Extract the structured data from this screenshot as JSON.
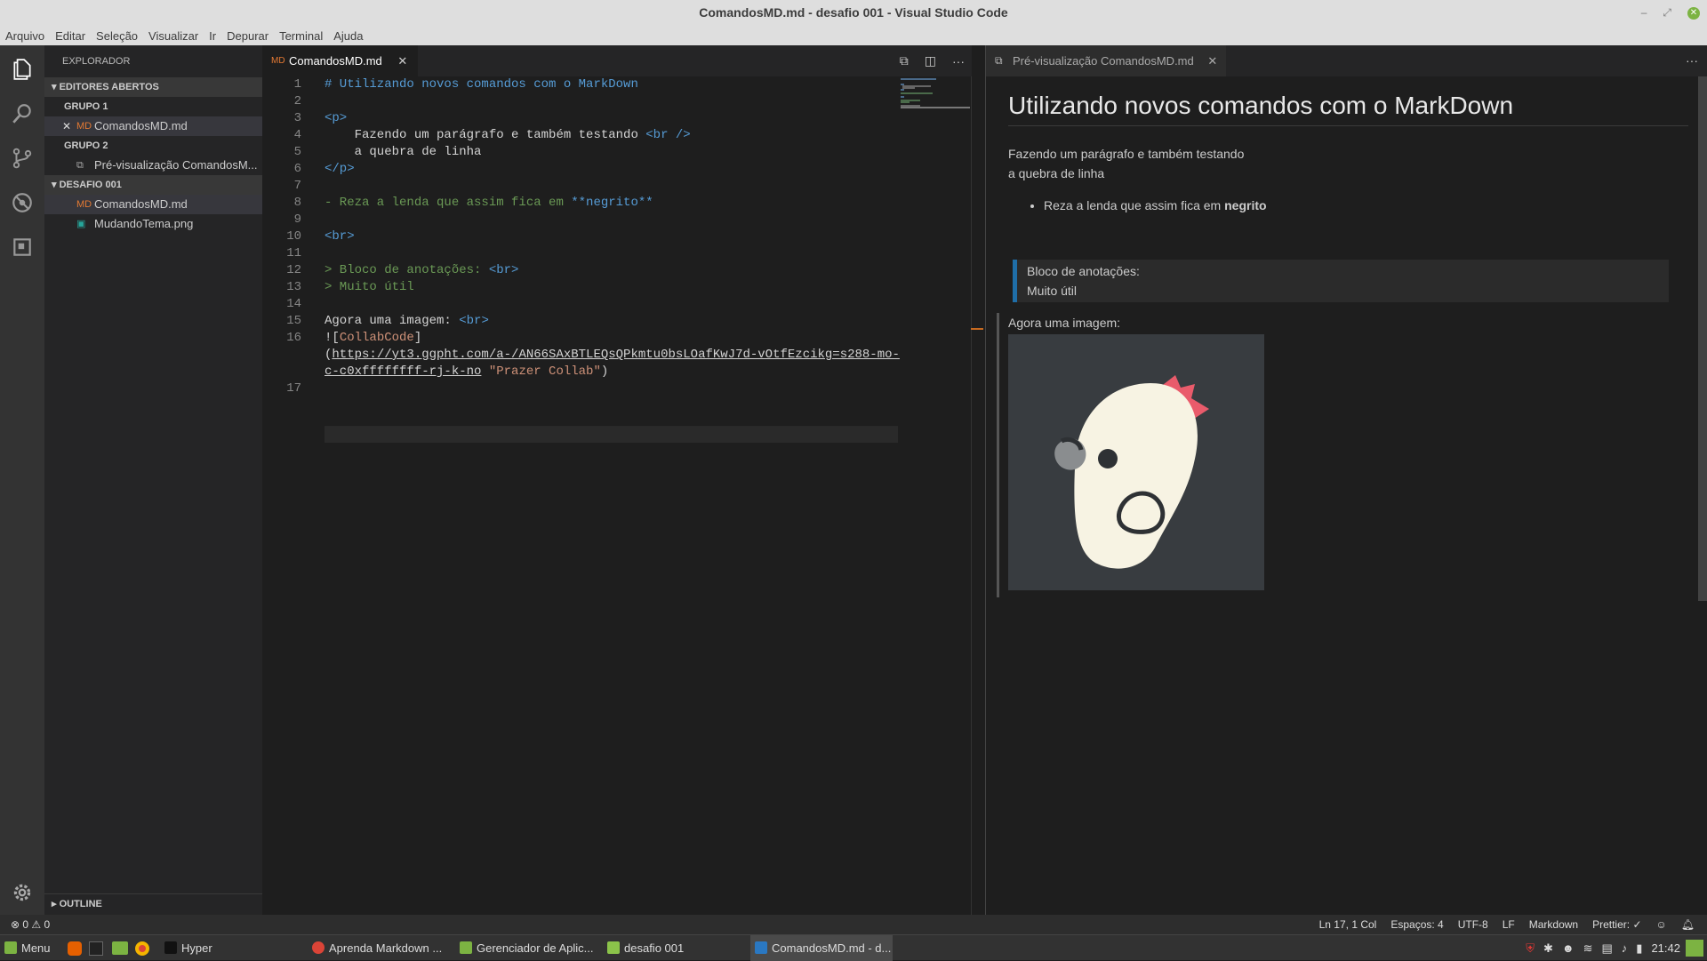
{
  "window": {
    "title": "ComandosMD.md - desafio 001 - Visual Studio Code"
  },
  "menu": [
    "Arquivo",
    "Editar",
    "Seleção",
    "Visualizar",
    "Ir",
    "Depurar",
    "Terminal",
    "Ajuda"
  ],
  "sidebar": {
    "title": "EXPLORADOR",
    "open_editors": "EDITORES ABERTOS",
    "group1": "GRUPO 1",
    "group1_file": "ComandosMD.md",
    "group2": "GRUPO 2",
    "group2_file": "Pré-visualização ComandosM...",
    "folder": "DESAFIO 001",
    "files": [
      "ComandosMD.md",
      "MudandoTema.png"
    ],
    "outline": "OUTLINE"
  },
  "editor": {
    "tab_label": "ComandosMD.md",
    "line_numbers": [
      "1",
      "2",
      "3",
      "4",
      "5",
      "6",
      "7",
      "8",
      "9",
      "10",
      "11",
      "12",
      "13",
      "14",
      "15",
      "16",
      "17"
    ],
    "lines": {
      "l1": "# Utilizando novos comandos com o MarkDown",
      "l3": "<p>",
      "l4_text": "    Fazendo um parágrafo e também testando ",
      "l4_tag": "<br />",
      "l5": "    a quebra de linha",
      "l6": "</p>",
      "l8_text": "- Reza a lenda que assim fica em ",
      "l8_bold": "**negrito**",
      "l10": "<br>",
      "l12_text": "> Bloco de anotações: ",
      "l12_tag": "<br>",
      "l13": "> Muito útil",
      "l15_text": "Agora uma imagem: ",
      "l15_tag": "<br>",
      "l16_a": "![",
      "l16_b": "CollabCode",
      "l16_c": "]",
      "l16_d": "(",
      "l16_url1": "https://yt3.ggpht.com/a-/AN66SAxBTLEQsQPkmtu0bsLOafKwJ7d-vOtfEzcikg=s288-mo-",
      "l16_url2": "c-c0xffffffff-rj-k-no",
      "l16_title": " \"Prazer Collab\"",
      "l16_end": ")"
    }
  },
  "preview": {
    "tab_label": "Pré-visualização ComandosMD.md",
    "h1": "Utilizando novos comandos com o MarkDown",
    "para_line1": "Fazendo um parágrafo e também testando",
    "para_line2": "a quebra de linha",
    "list_text": "Reza a lenda que assim fica em ",
    "list_bold": "negrito",
    "quote_line1": "Bloco de anotações:",
    "quote_line2": "Muito útil",
    "image_label": "Agora uma imagem:"
  },
  "status": {
    "errors": "0",
    "warnings": "0",
    "position": "Ln 17, 1 Col",
    "spaces": "Espaços: 4",
    "encoding": "UTF-8",
    "eol": "LF",
    "language": "Markdown",
    "prettier": "Prettier: ✓"
  },
  "taskbar": {
    "menu": "Menu",
    "items": [
      "Hyper",
      "Aprenda Markdown ...",
      "Gerenciador de Aplic...",
      "desafio 001",
      "ComandosMD.md - d..."
    ],
    "time": "21:42"
  },
  "colors": {
    "accent": "#1f6ea8",
    "keyword": "#569cd6",
    "comment": "#6a9955",
    "string": "#ce9178"
  }
}
